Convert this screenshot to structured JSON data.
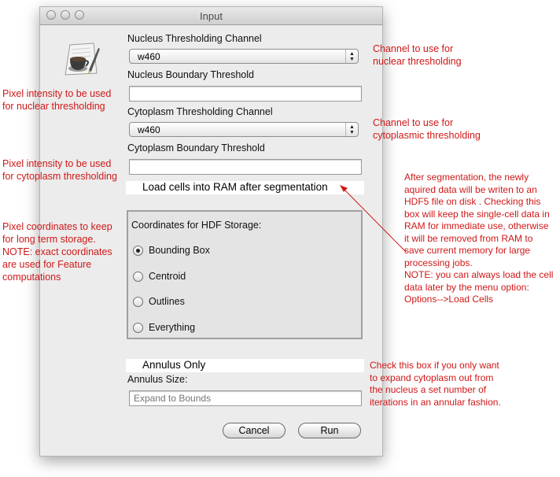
{
  "window": {
    "title": "Input"
  },
  "form": {
    "nucleus_channel_label": "Nucleus Thresholding Channel",
    "nucleus_channel_value": "w460",
    "nucleus_boundary_label": "Nucleus Boundary Threshold",
    "nucleus_boundary_value": "",
    "cyto_channel_label": "Cytoplasm Thresholding Channel",
    "cyto_channel_value": "w460",
    "cyto_boundary_label": "Cytoplasm Boundary Threshold",
    "cyto_boundary_value": "",
    "load_cells_label": "Load cells into RAM after segmentation",
    "hdf_group_title": "Coordinates for HDF Storage:",
    "hdf_options": [
      "Bounding Box",
      "Centroid",
      "Outlines",
      "Everything"
    ],
    "hdf_selected": "Bounding Box",
    "annulus_only_label": "Annulus Only",
    "annulus_size_label": "Annulus Size:",
    "annulus_size_placeholder": "Expand to Bounds"
  },
  "buttons": {
    "cancel": "Cancel",
    "run": "Run"
  },
  "annotations": {
    "nuclear_channel": [
      "Channel to use for",
      "nuclear thresholding"
    ],
    "nuclear_intensity": [
      "Pixel intensity to be used",
      "for nuclear thresholding"
    ],
    "cyto_channel": [
      "Channel to use for",
      "cytoplasmic thresholding"
    ],
    "cyto_intensity": [
      "Pixel intensity to be used",
      "for cytoplasm thresholding"
    ],
    "ram": [
      "After segmentation, the newly",
      "aquired data will be writen to an",
      "HDF5 file on disk . Checking this",
      "box will keep the single-cell data in",
      "RAM for immediate use, otherwise",
      "it will be removed from RAM to",
      "save current memory for large",
      "processing jobs.",
      "NOTE: you can always load the cell",
      "data later by the menu option:",
      "Options-->Load Cells"
    ],
    "coords": [
      "Pixel coordinates to keep",
      "for long term storage.",
      "NOTE: exact coordinates",
      "are used for Feature",
      "computations"
    ],
    "annulus": [
      "Check this box if you only want",
      "to expand cytoplasm out from",
      "the nucleus a set number of",
      "iterations in an annular fashion."
    ]
  },
  "colors": {
    "annotation": "#d01818",
    "window_bg": "#ececec"
  }
}
